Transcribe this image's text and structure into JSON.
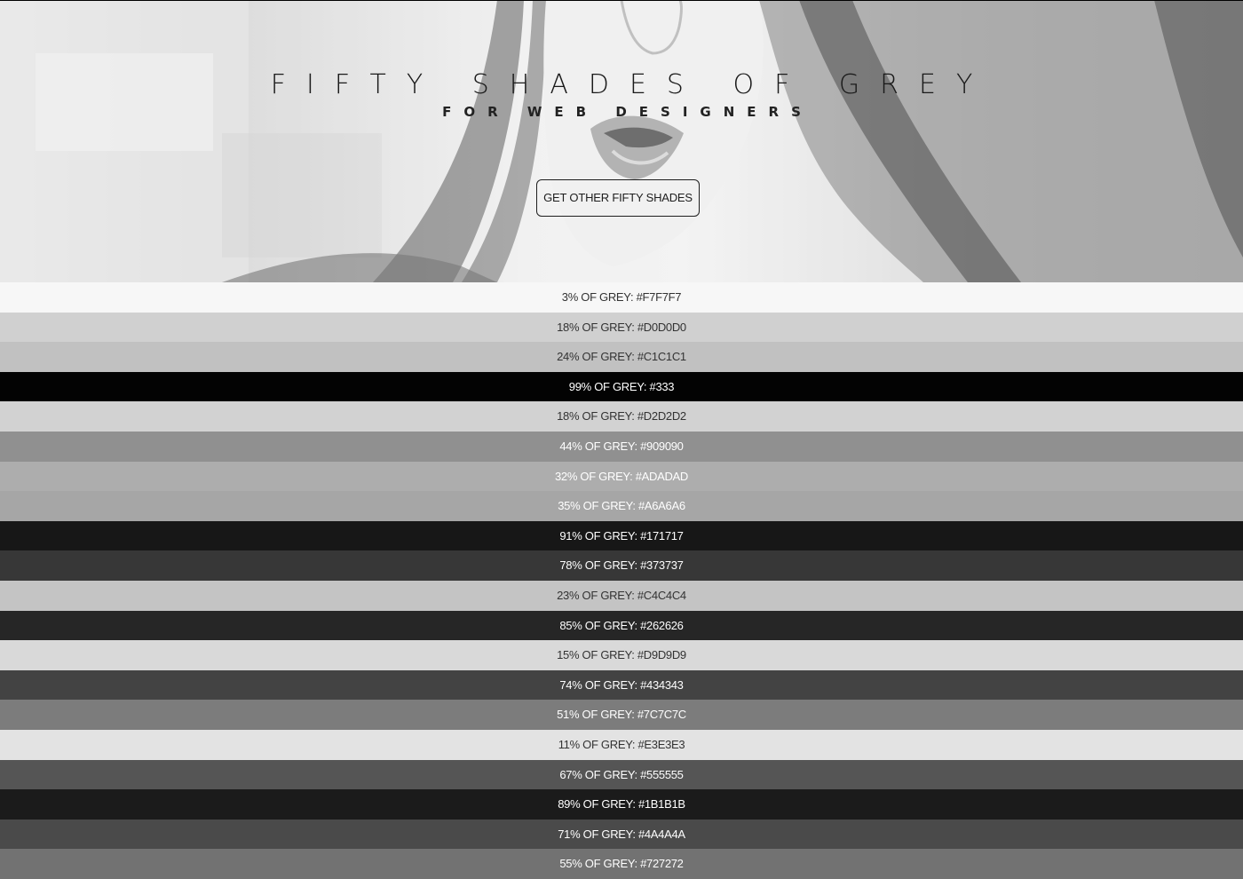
{
  "hero": {
    "title": "FIFTY SHADES OF GREY",
    "subtitle": "FOR WEB DESIGNERS",
    "button_label": "GET OTHER FIFTY SHADES"
  },
  "shades": [
    {
      "label": "3% OF GREY: #F7F7F7",
      "bg": "#F7F7F7",
      "fg": "#333333"
    },
    {
      "label": "18% OF GREY: #D0D0D0",
      "bg": "#D0D0D0",
      "fg": "#333333"
    },
    {
      "label": "24% OF GREY: #C1C1C1",
      "bg": "#C1C1C1",
      "fg": "#333333"
    },
    {
      "label": "99% OF GREY: #333",
      "bg": "#030303",
      "fg": "#ffffff"
    },
    {
      "label": "18% OF GREY: #D2D2D2",
      "bg": "#D2D2D2",
      "fg": "#333333"
    },
    {
      "label": "44% OF GREY: #909090",
      "bg": "#909090",
      "fg": "#ffffff"
    },
    {
      "label": "32% OF GREY: #ADADAD",
      "bg": "#ADADAD",
      "fg": "#ffffff"
    },
    {
      "label": "35% OF GREY: #A6A6A6",
      "bg": "#A6A6A6",
      "fg": "#ffffff"
    },
    {
      "label": "91% OF GREY: #171717",
      "bg": "#171717",
      "fg": "#ffffff"
    },
    {
      "label": "78% OF GREY: #373737",
      "bg": "#373737",
      "fg": "#ffffff"
    },
    {
      "label": "23% OF GREY: #C4C4C4",
      "bg": "#C4C4C4",
      "fg": "#333333"
    },
    {
      "label": "85% OF GREY: #262626",
      "bg": "#262626",
      "fg": "#ffffff"
    },
    {
      "label": "15% OF GREY: #D9D9D9",
      "bg": "#D9D9D9",
      "fg": "#333333"
    },
    {
      "label": "74% OF GREY: #434343",
      "bg": "#434343",
      "fg": "#ffffff"
    },
    {
      "label": "51% OF GREY: #7C7C7C",
      "bg": "#7C7C7C",
      "fg": "#ffffff"
    },
    {
      "label": "11% OF GREY: #E3E3E3",
      "bg": "#E3E3E3",
      "fg": "#333333"
    },
    {
      "label": "67% OF GREY: #555555",
      "bg": "#555555",
      "fg": "#ffffff"
    },
    {
      "label": "89% OF GREY: #1B1B1B",
      "bg": "#1B1B1B",
      "fg": "#ffffff"
    },
    {
      "label": "71% OF GREY: #4A4A4A",
      "bg": "#4A4A4A",
      "fg": "#ffffff"
    },
    {
      "label": "55% OF GREY: #727272",
      "bg": "#727272",
      "fg": "#ffffff"
    }
  ]
}
